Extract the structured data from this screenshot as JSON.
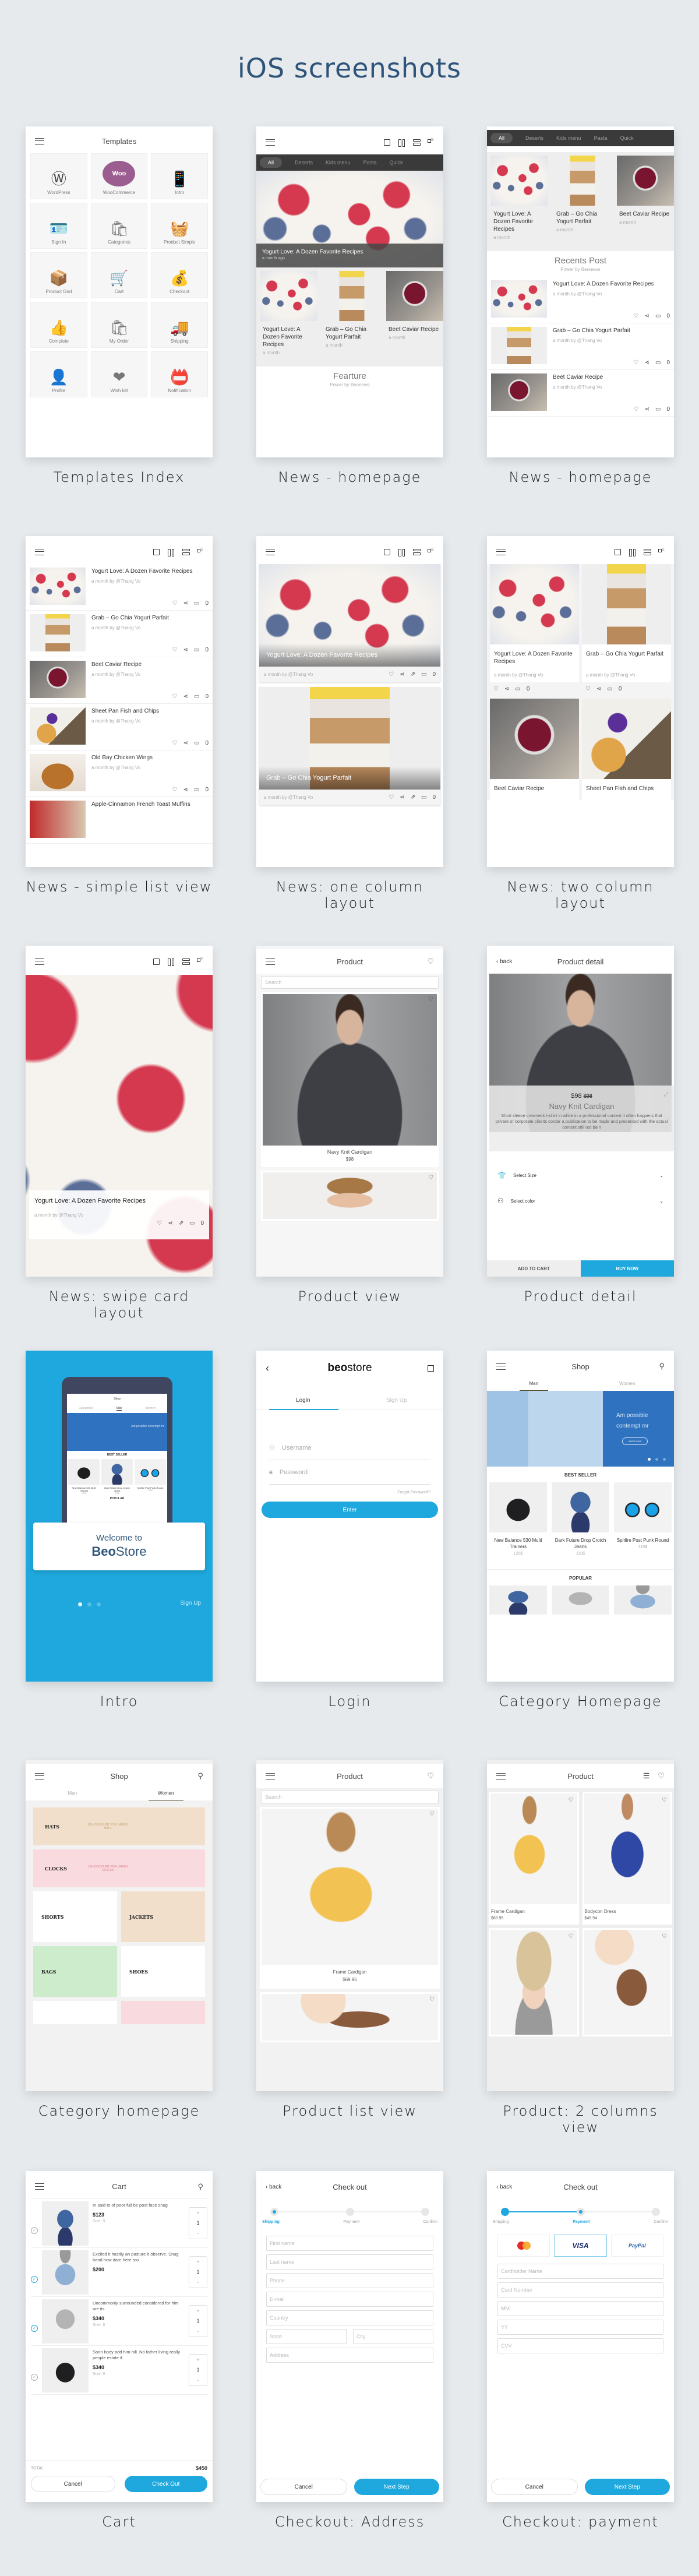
{
  "page": {
    "title": "iOS screenshots",
    "accent": "#1ea8dd",
    "title_color": "#2f5479",
    "background": "#e6eaed"
  },
  "screens": {
    "templates": {
      "caption": "Templates Index",
      "header": "Templates",
      "tiles": [
        {
          "label": "WordPress",
          "icon": "wordpress-logo",
          "glyph": "Ⓦ"
        },
        {
          "label": "WooCommerce",
          "icon": "woocommerce-logo",
          "glyph": "Woo"
        },
        {
          "label": "Intro",
          "icon": "phone-icon",
          "glyph": "📱"
        },
        {
          "label": "Sign In",
          "icon": "id-card-icon",
          "glyph": "🪪"
        },
        {
          "label": "Categories",
          "icon": "shopping-bags-icon",
          "glyph": "🛍"
        },
        {
          "label": "Product Simple",
          "icon": "basket-icon",
          "glyph": "🧺"
        },
        {
          "label": "Product Grid",
          "icon": "box-icon",
          "glyph": "📦"
        },
        {
          "label": "Cart",
          "icon": "cart-icon",
          "glyph": "🛒"
        },
        {
          "label": "Checkout",
          "icon": "hand-coins-icon",
          "glyph": "💰"
        },
        {
          "label": "Complete",
          "icon": "thumbs-up-icon",
          "glyph": "👍"
        },
        {
          "label": "My Order",
          "icon": "bag-check-icon",
          "glyph": "🛍"
        },
        {
          "label": "Shipping",
          "icon": "truck-icon",
          "glyph": "🚚"
        },
        {
          "label": "Profile",
          "icon": "user-icon",
          "glyph": "👤"
        },
        {
          "label": "Wish list",
          "icon": "heart-cart-icon",
          "glyph": "❤"
        },
        {
          "label": "Notification",
          "icon": "badge-icon",
          "glyph": "📛"
        }
      ]
    },
    "news_home_1": {
      "caption": "News - homepage",
      "tabs": [
        "All",
        "Deserts",
        "Kids menu",
        "Pasta",
        "Quick"
      ],
      "hero": {
        "title": "Yogurt Love: A Dozen Favorite Recipes",
        "meta": "a month ago"
      },
      "cards": [
        {
          "title": "Yogurt Love: A Dozen Favorite Recipes",
          "meta": "a month"
        },
        {
          "title": "Grab – Go Chia Yogurt Parfait",
          "meta": "a month"
        },
        {
          "title": "Beet Caviar Recipe",
          "meta": "a month"
        }
      ],
      "section": {
        "title": "Fearture",
        "subtitle": "Power by Beonews"
      }
    },
    "news_home_2": {
      "caption": "News - homepage",
      "tabs": [
        "All",
        "Deserts",
        "Kids menu",
        "Pasta",
        "Quick"
      ],
      "cards": [
        {
          "title": "Yogurt Love: A Dozen Favorite Recipes",
          "meta": "a month"
        },
        {
          "title": "Grab – Go Chia Yogurt Parfait",
          "meta": "a month"
        },
        {
          "title": "Beet Caviar Recipe",
          "meta": "a month"
        }
      ],
      "section": {
        "title": "Recents Post",
        "subtitle": "Power by Beonews"
      },
      "posts": [
        {
          "title": "Yogurt Love: A Dozen Favorite Recipes",
          "meta": "a month by @Thang Vo",
          "comments": "0"
        },
        {
          "title": "Grab – Go Chia Yogurt Parfait",
          "meta": "a month by @Thang Vo",
          "comments": "0"
        },
        {
          "title": "Beet Caviar Recipe",
          "meta": "a month by @Thang Vo",
          "comments": "0"
        }
      ]
    },
    "news_list": {
      "caption": "News - simple list view",
      "posts": [
        {
          "title": "Yogurt Love: A Dozen Favorite Recipes",
          "meta": "a month by @Thang Vo",
          "comments": "0"
        },
        {
          "title": "Grab – Go Chia Yogurt Parfait",
          "meta": "a month by @Thang Vo",
          "comments": "0"
        },
        {
          "title": "Beet Caviar Recipe",
          "meta": "a month by @Thang Vo",
          "comments": "0"
        },
        {
          "title": "Sheet Pan Fish and Chips",
          "meta": "a month by @Thang Vo",
          "comments": "0"
        },
        {
          "title": "Old Bay Chicken Wings",
          "meta": "a month by @Thang Vo",
          "comments": "0"
        },
        {
          "title": "Apple-Cinnamon French Toast Muffins",
          "meta": "",
          "comments": ""
        }
      ]
    },
    "news_one_col": {
      "caption": "News: one column layout",
      "posts": [
        {
          "title": "Yogurt Love: A Dozen Favorite Recipes",
          "meta": "a month by @Thang Vo",
          "comments": "0"
        },
        {
          "title": "Grab – Go Chia Yogurt Parfait",
          "meta": "a month by @Thang Vo",
          "comments": "0"
        }
      ]
    },
    "news_two_col": {
      "caption": "News: two column layout",
      "posts": [
        {
          "title": "Yogurt Love: A Dozen Favorite Recipes",
          "meta": "a month by @Thang Vo",
          "comments": "0"
        },
        {
          "title": "Grab – Go Chia Yogurt Parfait",
          "meta": "a month by @Thang Vo",
          "comments": "0"
        },
        {
          "title": "Beet Caviar Recipe",
          "meta": "",
          "comments": ""
        },
        {
          "title": "Sheet Pan Fish and Chips",
          "meta": "",
          "comments": ""
        }
      ]
    },
    "news_swipe": {
      "caption": "News: swipe card layout",
      "post": {
        "title": "Yogurt Love: A Dozen Favorite Recipes",
        "meta": "a month by @Thang Vo",
        "comments": "0"
      }
    },
    "product_view": {
      "caption": "Product view",
      "header": "Product",
      "search_placeholder": "Search",
      "items": [
        {
          "name": "Navy Knit Cardigan",
          "price": "$98"
        }
      ]
    },
    "product_detail": {
      "caption": "Product detail",
      "back": "back",
      "header": "Product detail",
      "price": "$98",
      "old_price": "$98",
      "name": "Navy Knit Cardigan",
      "description": "Short sleeve crewneck t-shirt in white in a professional context it often happens that private or corporate clients corder a publication to be made and presented with the actual content still not bein",
      "select_size": "Select Size",
      "select_color": "Select color",
      "add_to_cart": "ADD TO CART",
      "buy_now": "BUY NOW"
    },
    "intro": {
      "caption": "Intro",
      "welcome": "Welcome to",
      "brand_bold": "Beo",
      "brand_rest": "Store",
      "sign_up": "Sign Up",
      "slide_index": 1,
      "slide_count": 3,
      "mock": {
        "header": "Shop",
        "tabs": [
          "Categories",
          "Man",
          "Women"
        ],
        "banner": "Am possible contempt mr",
        "section": "BEST SELLER",
        "popular": "POPULAR",
        "items": [
          {
            "name": "New Balance 530 Multi Trainers",
            "price": "120$"
          },
          {
            "name": "Dark Future Drop Crotch Jeans",
            "price": "110$"
          },
          {
            "name": "Spitfire Post Punk Round",
            "price": "110$"
          }
        ]
      }
    },
    "login": {
      "caption": "Login",
      "brand_bold": "beo",
      "brand_rest": "store",
      "tabs": [
        "Login",
        "Sign Up"
      ],
      "username_placeholder": "Username",
      "password_placeholder": "Password",
      "forgot": "Forgot Password?",
      "enter": "Enter"
    },
    "category_man": {
      "caption": "Category Homepage",
      "header": "Shop",
      "tabs": [
        "Man",
        "Women"
      ],
      "banner": {
        "line1": "Am possible",
        "line2": "contempt mr",
        "cta": "SHOP NOW"
      },
      "best_seller": "BEST SELLER",
      "popular": "POPULAR",
      "items": [
        {
          "name": "New Balance 530 Multi Trainers",
          "price": "120$"
        },
        {
          "name": "Dark Future Drop Crotch Jeans",
          "price": "110$"
        },
        {
          "name": "Spitfire Post Punk Round",
          "price": "110$"
        }
      ]
    },
    "category_women": {
      "caption": "Category homepage",
      "header": "Shop",
      "tabs": [
        "Man",
        "Women"
      ],
      "banners": [
        {
          "label": "HATS",
          "promo": "20% DISCOUNT FOR LADIES HATS",
          "color": "#f1dfcb"
        },
        {
          "label": "CLOCKS",
          "promo": "15% DISCOUNT FOR LADIES CLOCKS",
          "color": "#f9dade"
        }
      ],
      "tiles": [
        {
          "label": "SHORTS",
          "color": "#ffffff"
        },
        {
          "label": "JACKETS",
          "color": "#f1dfcb"
        },
        {
          "label": "BAGS",
          "color": "#cdeccb"
        },
        {
          "label": "SHOES",
          "color": "#ffffff"
        }
      ]
    },
    "product_list": {
      "caption": "Product list view",
      "header": "Product",
      "search_placeholder": "Search",
      "items": [
        {
          "name": "Frame Cardigan",
          "price": "$69.95"
        }
      ]
    },
    "product_grid": {
      "caption": "Product: 2 columns view",
      "header": "Product",
      "items": [
        {
          "name": "Frame Cardigan",
          "price": "$69.95"
        },
        {
          "name": "Bodycon Dress",
          "price": "$49.94"
        },
        {
          "name": "",
          "price": ""
        },
        {
          "name": "",
          "price": ""
        }
      ]
    },
    "cart": {
      "caption": "Cart",
      "header": "Cart",
      "items": [
        {
          "desc": "In said to of poor full be post face snug",
          "price": "$123",
          "size": "Size: 9",
          "qty": "1",
          "checked": false
        },
        {
          "desc": "Excited it hastily an pasture it observe. Snug hand how dare here too.",
          "price": "$200",
          "size": "",
          "qty": "1",
          "checked": true
        },
        {
          "desc": "Uncommonly surrounded considered for him are its",
          "price": "$340",
          "size": "Size: 8",
          "qty": "1",
          "checked": true
        },
        {
          "desc": "Soon body add him hill. No father living really people estate if.",
          "price": "$340",
          "size": "Size: 8",
          "qty": "1",
          "checked": false
        }
      ],
      "total_label": "TOTAL",
      "total": "$450",
      "cancel": "Cancel",
      "checkout": "Check Out"
    },
    "checkout_address": {
      "caption": "Checkout: Address",
      "back": "back",
      "header": "Check out",
      "steps": [
        "Shipping",
        "Payment",
        "Confirm"
      ],
      "current_step": 1,
      "fields": {
        "first": "First name",
        "last": "Last name",
        "phone": "Phone",
        "email": "E-mail",
        "country": "Country",
        "state": "State",
        "city": "City",
        "address": "Address"
      },
      "cancel": "Cancel",
      "next": "Next Step"
    },
    "checkout_payment": {
      "caption": "Checkout: payment",
      "back": "back",
      "header": "Check out",
      "steps": [
        "Shipping",
        "Payment",
        "Confirm"
      ],
      "current_step": 2,
      "methods": [
        "MasterCard",
        "VISA",
        "PayPal"
      ],
      "selected_method": "VISA",
      "fields": [
        "Cardholder Name",
        "Card Number",
        "MM",
        "YY",
        "CVV"
      ],
      "cancel": "Cancel",
      "next": "Next Step"
    }
  }
}
